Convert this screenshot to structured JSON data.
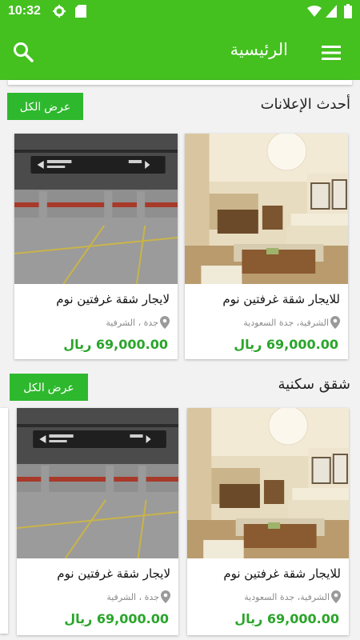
{
  "status_bar": {
    "time": "10:32"
  },
  "app_bar": {
    "title": "الرئيسية"
  },
  "sections": [
    {
      "title": "أحدث الإعلانات",
      "view_all_label": "عرض الكل",
      "cards": [
        {
          "title": "للايجار شقة غرفتين نوم",
          "location": "الشرفية، جدة السعودية",
          "price": "69,000.00 ريال",
          "photo": "apartment-living-room"
        },
        {
          "title": "لايجار شقة غرفتين نوم",
          "location": "جدة ، الشرفية",
          "price": "69,000.00 ريال",
          "photo": "parking-garage"
        }
      ]
    },
    {
      "title": "شقق سكنية",
      "view_all_label": "عرض الكل",
      "cards": [
        {
          "title": "للايجار شقة غرفتين نوم",
          "location": "الشرفية، جدة السعودية",
          "price": "69,000.00 ريال",
          "photo": "apartment-living-room"
        },
        {
          "title": "لايجار شقة غرفتين نوم",
          "location": "جدة ، الشرفية",
          "price": "69,000.00 ريال",
          "photo": "parking-garage"
        }
      ]
    }
  ],
  "colors": {
    "primary": "#44c01f",
    "button": "#2eb82e",
    "price": "#2aa52a",
    "background": "#f2f2f2"
  },
  "icons": [
    "gear-icon",
    "sd-card-icon",
    "wifi-icon",
    "signal-icon",
    "battery-icon",
    "search-icon",
    "menu-icon",
    "location-pin-icon"
  ]
}
